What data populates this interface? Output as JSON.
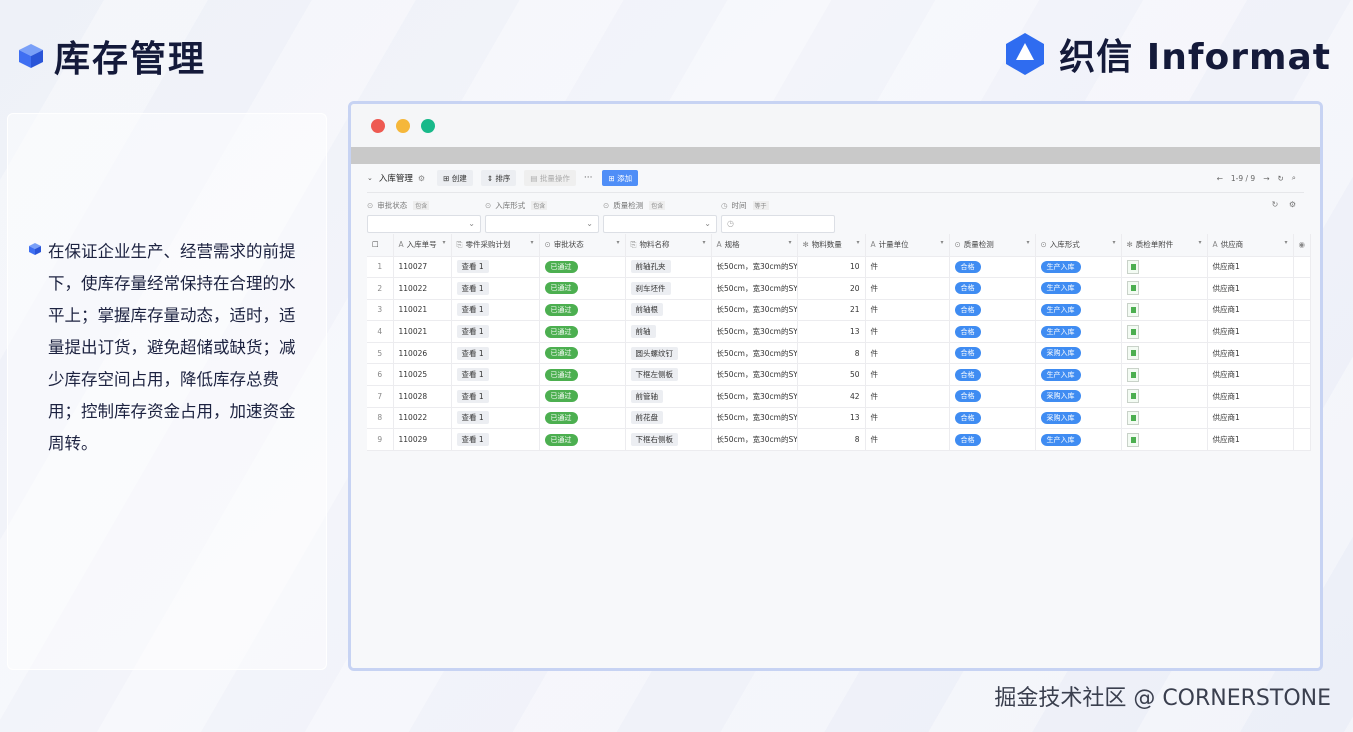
{
  "page": {
    "title": "库存管理",
    "brand": "织信 Informat",
    "watermark": "掘金技术社区 @ CORNERSTONE",
    "description": "在保证企业生产、经营需求的前提下，使库存量经常保持在合理的水平上；掌握库存量动态，适时，适量提出订货，避免超储或缺货；减少库存空间占用，降低库存总费用；控制库存资金占用，加速资金周转。"
  },
  "colors": {
    "accent": "#3f6ff2",
    "approved": "#4caf50",
    "tag_blue": "#3f8cf2",
    "window_border": "#c7d3f3"
  },
  "toolbar": {
    "view_title": "入库管理",
    "create_label": "创建",
    "sort_label": "排序",
    "batch_label": "批量操作",
    "more_label": "···",
    "add_label": "添加",
    "pagination": "1-9 / 9"
  },
  "filters": [
    {
      "label": "审批状态",
      "tag": "包含"
    },
    {
      "label": "入库形式",
      "tag": "包含"
    },
    {
      "label": "质量检测",
      "tag": "包含"
    },
    {
      "label": "时间",
      "tag": "等于"
    }
  ],
  "table": {
    "columns": [
      "入库单号",
      "零件采购计划",
      "审批状态",
      "物料名称",
      "规格",
      "物料数量",
      "计量单位",
      "质量检测",
      "入库形式",
      "质检单附件",
      "供应商"
    ],
    "rows": [
      {
        "idx": "1",
        "order": "110027",
        "plan": "查看 1",
        "status": "已通过",
        "material": "前轴孔夹",
        "spec": "长50cm，宽30cm的SY7",
        "qty": "10",
        "unit": "件",
        "qc": "合格",
        "form": "生产入库",
        "supplier": "供应商1"
      },
      {
        "idx": "2",
        "order": "110022",
        "plan": "查看 1",
        "status": "已通过",
        "material": "刹车坯件",
        "spec": "长50cm，宽30cm的SY7",
        "qty": "20",
        "unit": "件",
        "qc": "合格",
        "form": "生产入库",
        "supplier": "供应商1"
      },
      {
        "idx": "3",
        "order": "110021",
        "plan": "查看 1",
        "status": "已通过",
        "material": "前轴根",
        "spec": "长50cm，宽30cm的SY7",
        "qty": "21",
        "unit": "件",
        "qc": "合格",
        "form": "生产入库",
        "supplier": "供应商1"
      },
      {
        "idx": "4",
        "order": "110021",
        "plan": "查看 1",
        "status": "已通过",
        "material": "前轴",
        "spec": "长50cm，宽30cm的SY7",
        "qty": "13",
        "unit": "件",
        "qc": "合格",
        "form": "生产入库",
        "supplier": "供应商1"
      },
      {
        "idx": "5",
        "order": "110026",
        "plan": "查看 1",
        "status": "已通过",
        "material": "圆头螺纹钉",
        "spec": "长50cm，宽30cm的SY7",
        "qty": "8",
        "unit": "件",
        "qc": "合格",
        "form": "采购入库",
        "supplier": "供应商1"
      },
      {
        "idx": "6",
        "order": "110025",
        "plan": "查看 1",
        "status": "已通过",
        "material": "下框左侧板",
        "spec": "长50cm，宽30cm的SY7",
        "qty": "50",
        "unit": "件",
        "qc": "合格",
        "form": "生产入库",
        "supplier": "供应商1"
      },
      {
        "idx": "7",
        "order": "110028",
        "plan": "查看 1",
        "status": "已通过",
        "material": "前管轴",
        "spec": "长50cm，宽30cm的SY7",
        "qty": "42",
        "unit": "件",
        "qc": "合格",
        "form": "采购入库",
        "supplier": "供应商1"
      },
      {
        "idx": "8",
        "order": "110022",
        "plan": "查看 1",
        "status": "已通过",
        "material": "前花盘",
        "spec": "长50cm，宽30cm的SY7",
        "qty": "13",
        "unit": "件",
        "qc": "合格",
        "form": "采购入库",
        "supplier": "供应商1"
      },
      {
        "idx": "9",
        "order": "110029",
        "plan": "查看 1",
        "status": "已通过",
        "material": "下框右侧板",
        "spec": "长50cm，宽30cm的SY7",
        "qty": "8",
        "unit": "件",
        "qc": "合格",
        "form": "生产入库",
        "supplier": "供应商1"
      }
    ]
  }
}
